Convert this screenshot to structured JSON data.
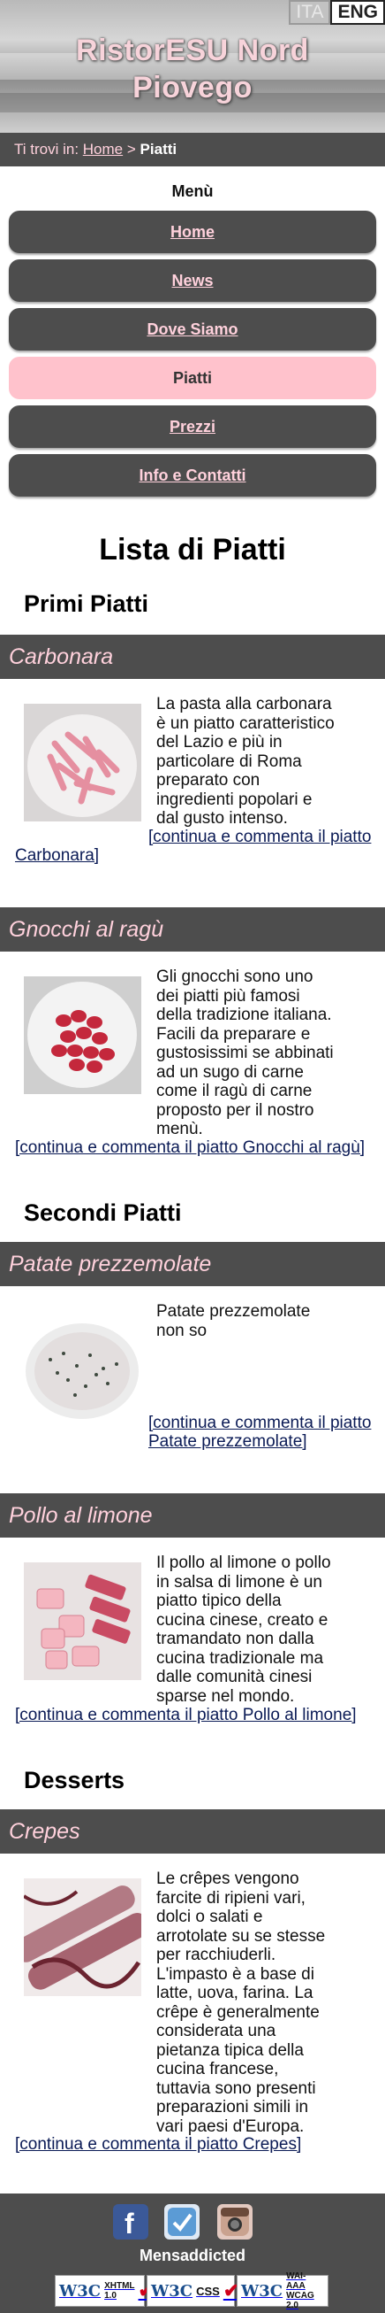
{
  "header": {
    "title_line1": "RistorESU Nord",
    "title_line2": "Piovego",
    "lang": {
      "ita": "ITA",
      "eng": "ENG"
    }
  },
  "breadcrumb": {
    "prefix": "Ti trovi in:",
    "home": "Home",
    "separator": ">",
    "current": "Piatti"
  },
  "menu": {
    "title": "Menù",
    "items": [
      {
        "label": "Home",
        "active": false
      },
      {
        "label": "News",
        "active": false
      },
      {
        "label": "Dove Siamo",
        "active": false
      },
      {
        "label": "Piatti",
        "active": true
      },
      {
        "label": "Prezzi",
        "active": false
      },
      {
        "label": "Info e Contatti",
        "active": false
      }
    ]
  },
  "main": {
    "heading": "Lista di Piatti",
    "sections": [
      {
        "title": "Primi Piatti"
      },
      {
        "title": "Secondi Piatti"
      },
      {
        "title": "Desserts"
      }
    ],
    "dishes": [
      {
        "name": "Carbonara",
        "lines": [
          "La pasta alla carbonara",
          "è un piatto caratteristico",
          "del Lazio e più in",
          "particolare di Roma",
          "preparato con",
          "ingredienti popolari e",
          "dal gusto intenso."
        ],
        "link_line1": "[continua e commenta il piatto",
        "link_line2": "Carbonara]"
      },
      {
        "name": "Gnocchi al ragù",
        "lines": [
          "Gli gnocchi sono uno",
          "dei piatti più famosi",
          "della tradizione italiana.",
          "Facili da preparare e",
          "gustosissimi se abbinati",
          "ad un sugo di carne",
          "come il ragù di carne",
          "proposto per il nostro",
          "menù."
        ],
        "link_line1": "[continua e commenta il piatto Gnocchi al ragù]"
      },
      {
        "name": "Patate prezzemolate",
        "lines": [
          "Patate prezzemolate",
          "non so"
        ],
        "link_line1": "[continua e commenta il piatto",
        "link_line2": "Patate prezzemolate]"
      },
      {
        "name": "Pollo al limone",
        "lines": [
          "Il pollo al limone o pollo",
          "in salsa di limone è un",
          "piatto tipico della",
          "cucina cinese, creato e",
          "tramandato non dalla",
          "cucina tradizionale ma",
          "dalle comunità cinesi",
          "sparse nel mondo."
        ],
        "link_line1": "[continua e commenta il piatto Pollo al limone]"
      },
      {
        "name": "Crepes",
        "lines": [
          "Le crêpes vengono",
          "farcite di ripieni vari,",
          "dolci o salati e",
          "arrotolate su se stesse",
          "per racchiuderli.",
          "L'impasto è a base di",
          "latte, uova, farina. La",
          "crêpe è generalmente",
          "considerata una",
          "pietanza tipica della",
          "cucina francese,",
          "tuttavia sono presenti",
          "preparazioni simili in",
          "vari paesi d'Europa."
        ],
        "link_line1": "[continua e commenta il piatto Crepes]"
      }
    ]
  },
  "footer": {
    "name": "Mensaddicted",
    "social": [
      "facebook-icon",
      "tweet-icon",
      "instagram-icon"
    ],
    "badges": [
      {
        "w3c": "W3C",
        "std1": "XHTML",
        "std2": "1.0"
      },
      {
        "w3c": "W3C",
        "std1": "CSS",
        "std2": ""
      },
      {
        "w3c": "W3C",
        "std1": "WAI-AAA",
        "std2": "WCAG 2.0"
      }
    ]
  },
  "colors": {
    "bar": "#4d4d4d",
    "pink_text": "#ffd1dc",
    "active_menu": "#ffc2cc"
  }
}
